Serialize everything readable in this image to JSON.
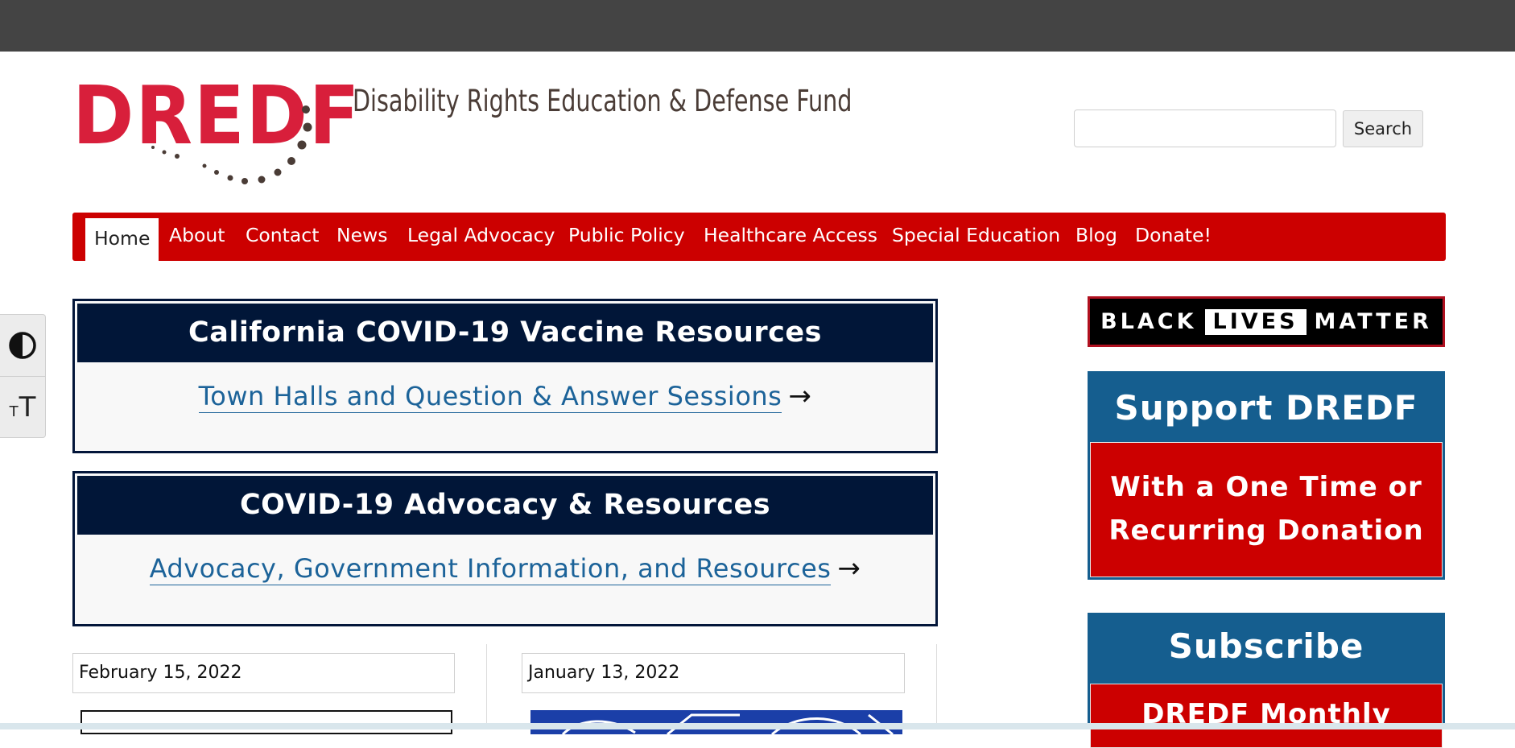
{
  "header": {
    "logo_text": "DREDF",
    "tagline": "Disability Rights Education & Defense Fund",
    "search": {
      "value": "",
      "placeholder": "",
      "button_label": "Search"
    }
  },
  "nav": {
    "items": [
      {
        "label": "Home",
        "active": true
      },
      {
        "label": "About"
      },
      {
        "label": "Contact"
      },
      {
        "label": "News"
      },
      {
        "label": "Legal Advocacy"
      },
      {
        "label": "Public Policy"
      },
      {
        "label": "Healthcare Access"
      },
      {
        "label": "Special Education"
      },
      {
        "label": "Blog"
      },
      {
        "label": "Donate!"
      }
    ]
  },
  "accessibility": {
    "contrast_icon": "contrast-icon",
    "text_size_icon": "text-size-icon",
    "text_size_glyph_small": "T",
    "text_size_glyph_large": "T"
  },
  "features": [
    {
      "heading": "California COVID-19 Vaccine Resources",
      "link": "Town Halls and Question & Answer Sessions",
      "arrow": "→"
    },
    {
      "heading": "COVID-19 Advocacy & Resources",
      "link": "Advocacy, Government Information, and Resources",
      "arrow": "→"
    }
  ],
  "posts": [
    {
      "date": "February 15, 2022"
    },
    {
      "date": "January 13, 2022"
    }
  ],
  "sidebar": {
    "blm": {
      "black": "BLACK",
      "lives": "LIVES",
      "matter": "MATTER"
    },
    "support": {
      "title": "Support DREDF",
      "button_line1": "With a One Time or",
      "button_line2": "Recurring Donation"
    },
    "subscribe": {
      "title": "Subscribe",
      "button": "DREDF Monthly"
    }
  },
  "colors": {
    "brand_red": "#d81f3b",
    "nav_red": "#cc0000",
    "navy": "#011638",
    "link_blue": "#1c6399",
    "sidebar_blue": "#155e8f"
  }
}
